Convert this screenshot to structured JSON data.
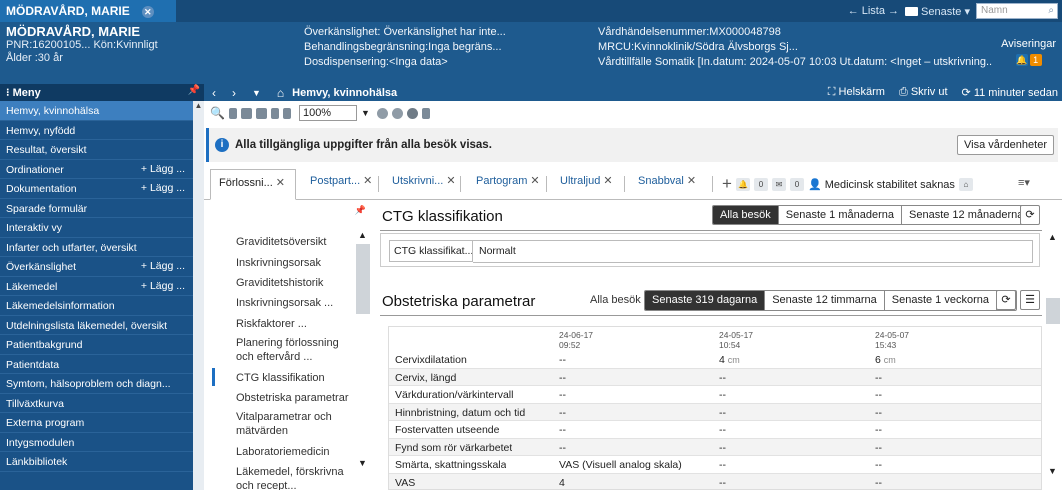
{
  "window": {
    "patient_tab": "MÖDRAVÅRD, MARIE",
    "nav_list": "← Lista →",
    "nav_recent": "Senaste ▾",
    "search_placeholder": "Namn"
  },
  "patient": {
    "name": "MÖDRAVÅRD, MARIE",
    "pnr": "PNR:16200105... Kön:Kvinnligt",
    "age": "Ålder :30 år",
    "hypersensitivity": "Överkänslighet: Överkänslighet har inte...",
    "treatment_limit": "Behandlingsbegränsning:Inga begräns...",
    "dose_dispensing": "Dosdispensering:<Inga data>",
    "care_event": "Vårdhändelsenummer:MX000048798",
    "mrcu": "MRCU:Kvinnoklinik/Södra Älvsborgs Sj...",
    "care_occasion": "Vårdtillfälle Somatik [In.datum: 2024-05-07 10:03 Ut.datum: <Inget – utskrivning...",
    "avis_label": "Aviseringar",
    "avis_count": "1"
  },
  "sidebar": {
    "title": "Meny",
    "items": [
      {
        "label": "Hemvy, kvinnohälsa",
        "add": ""
      },
      {
        "label": "Hemvy, nyfödd",
        "add": ""
      },
      {
        "label": "Resultat, översikt",
        "add": ""
      },
      {
        "label": "Ordinationer",
        "add": "+ Lägg ..."
      },
      {
        "label": "Dokumentation",
        "add": "+ Lägg ..."
      },
      {
        "label": "Sparade formulär",
        "add": ""
      },
      {
        "label": "Interaktiv vy",
        "add": ""
      },
      {
        "label": "Infarter och utfarter, översikt",
        "add": ""
      },
      {
        "label": "Överkänslighet",
        "add": "+ Lägg ..."
      },
      {
        "label": "Läkemedel",
        "add": "+ Lägg ..."
      },
      {
        "label": "Läkemedelsinformation",
        "add": ""
      },
      {
        "label": "Utdelningslista läkemedel, översikt",
        "add": ""
      },
      {
        "label": "Patientbakgrund",
        "add": ""
      },
      {
        "label": "Patientdata",
        "add": ""
      },
      {
        "label": "Symtom, hälsoproblem och diagn...",
        "add": ""
      },
      {
        "label": "Tillväxtkurva",
        "add": ""
      },
      {
        "label": "Externa program",
        "add": ""
      },
      {
        "label": "Intygsmodulen",
        "add": ""
      },
      {
        "label": "Länkbibliotek",
        "add": ""
      }
    ]
  },
  "toolbar": {
    "page_title": "Hemvy, kvinnohälsa",
    "fullscreen": "Helskärm",
    "print": "Skriv ut",
    "updated": "11 minuter sedan",
    "zoom": "100%"
  },
  "alert": {
    "text": "Alla tillgängliga uppgifter från alla besök visas.",
    "button": "Visa vårdenheter"
  },
  "tabs": {
    "items": [
      "Förlossni...",
      "Postpart...",
      "Utskrivni...",
      "Partogram",
      "Ultraljud",
      "Snabbval"
    ],
    "badge1": "0",
    "badge2": "0",
    "stability": "Medicinsk stabilitet saknas"
  },
  "leftnav": {
    "items": [
      "Graviditetsöversikt",
      "Inskrivningsorsak",
      "Graviditetshistorik",
      "Inskrivningsorsak ...",
      "Riskfaktorer ...",
      "Planering förlossning och eftervård ...",
      "CTG klassifikation",
      "Obstetriska parametrar",
      "Vitalparametrar och mätvärden",
      "Laboratoriemedicin",
      "Läkemedel, förskrivna och recept..."
    ]
  },
  "ctg": {
    "title": "CTG klassifikation",
    "filters": [
      "Alla besök",
      "Senaste 1 månaderna",
      "Senaste 12 månaderna"
    ],
    "label": "CTG klassifikat...",
    "value": "Normalt"
  },
  "obstetric": {
    "title": "Obstetriska parametrar",
    "all_visits": "Alla besök",
    "filters": [
      "Senaste 319 dagarna",
      "Senaste 12 timmarna",
      "Senaste 1 veckorna"
    ],
    "columns": [
      {
        "date": "24-06-17",
        "time": "09:52"
      },
      {
        "date": "24-05-17",
        "time": "10:54"
      },
      {
        "date": "24-05-07",
        "time": "15:43"
      }
    ],
    "rows": [
      {
        "label": "Cervixdilatation",
        "v": [
          "--",
          "4",
          "6"
        ],
        "unit": "cm"
      },
      {
        "label": "Cervix, längd",
        "v": [
          "--",
          "--",
          "--"
        ],
        "unit": ""
      },
      {
        "label": "Värkduration/värkintervall",
        "v": [
          "--",
          "--",
          "--"
        ],
        "unit": ""
      },
      {
        "label": "Hinnbristning, datum och tid",
        "v": [
          "--",
          "--",
          "--"
        ],
        "unit": ""
      },
      {
        "label": "Fostervatten utseende",
        "v": [
          "--",
          "--",
          "--"
        ],
        "unit": ""
      },
      {
        "label": "Fynd som rör värkarbetet",
        "v": [
          "--",
          "--",
          "--"
        ],
        "unit": ""
      },
      {
        "label": "Smärta, skattningsskala",
        "v": [
          "VAS (Visuell analog skala)",
          "--",
          "--"
        ],
        "unit": ""
      },
      {
        "label": "VAS",
        "v": [
          "4",
          "--",
          "--"
        ],
        "unit": ""
      }
    ]
  }
}
